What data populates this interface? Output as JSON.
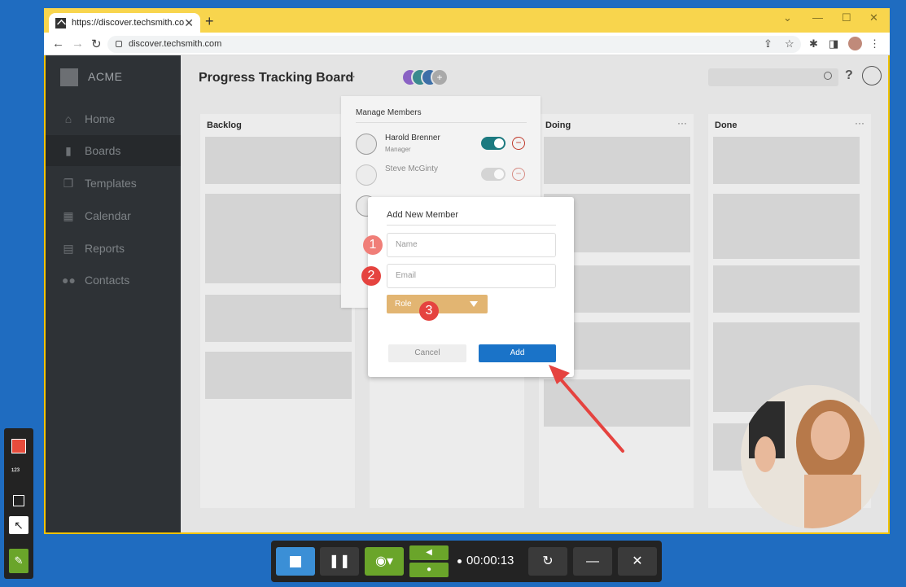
{
  "browser": {
    "tab_title": "https://discover.techsmith.com",
    "new_tab": "+",
    "tab_close": "✕",
    "url": "discover.techsmith.com"
  },
  "app": {
    "brand": "ACME",
    "board_title": "Progress Tracking Board",
    "board_more": "···",
    "help": "?",
    "nav": [
      {
        "label": "Home",
        "icon": "home-icon"
      },
      {
        "label": "Boards",
        "icon": "boards-icon"
      },
      {
        "label": "Templates",
        "icon": "templates-icon"
      },
      {
        "label": "Calendar",
        "icon": "calendar-icon"
      },
      {
        "label": "Reports",
        "icon": "reports-icon"
      },
      {
        "label": "Contacts",
        "icon": "contacts-icon"
      }
    ],
    "active_nav": "Boards",
    "columns": [
      {
        "title": "Backlog"
      },
      {
        "title": "Doing"
      },
      {
        "title": "Done"
      }
    ],
    "column_more": "···"
  },
  "manage_members": {
    "title": "Manage Members",
    "members": [
      {
        "name": "Harold Brenner",
        "role": "Manager",
        "enabled": true
      },
      {
        "name": "Steve McGinty",
        "role": "",
        "enabled": false
      }
    ],
    "remove": "−"
  },
  "dialog": {
    "title": "Add New Member",
    "name_placeholder": "Name",
    "email_placeholder": "Email",
    "role_label": "Role",
    "cancel_label": "Cancel",
    "add_label": "Add"
  },
  "steps": [
    "1",
    "2",
    "3"
  ],
  "recorder": {
    "time": "00:00:13",
    "pause": "❚❚",
    "restart": "↻",
    "minimize": "—",
    "close": "✕",
    "steps_tool": "¹²³",
    "arrow_tool": "↖",
    "note_tool": "✎"
  },
  "colors": {
    "accent": "#1a73c8",
    "toggle_on": "#1c7a80",
    "step_marker": "#e5433f",
    "role_select": "#e2b572",
    "browser_frame": "#f8d54d",
    "recorder_green": "#6aa52a"
  }
}
